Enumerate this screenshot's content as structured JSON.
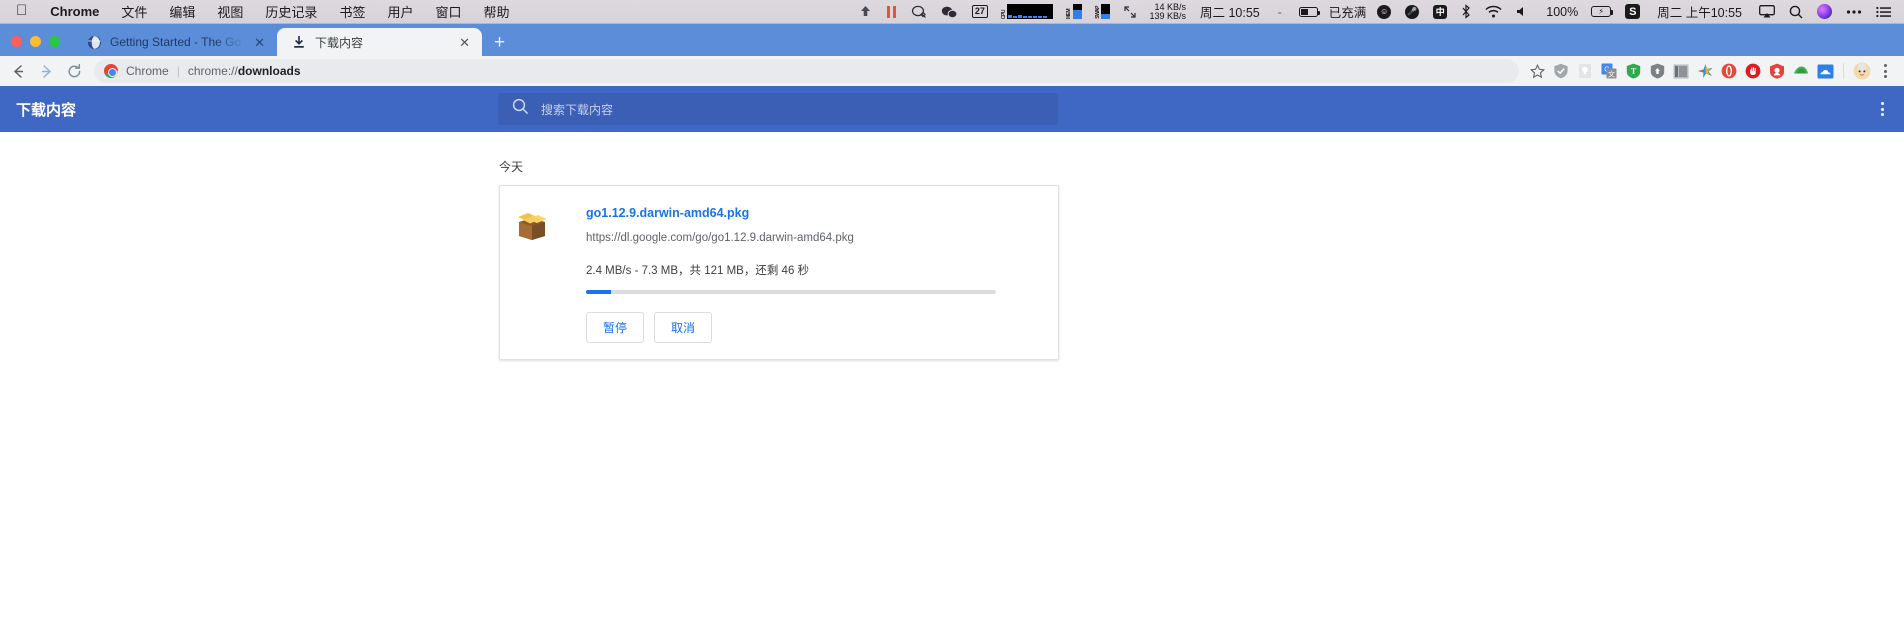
{
  "macos_menubar": {
    "apple_logo": "apple-logo",
    "app_name": "Chrome",
    "menus": [
      "文件",
      "编辑",
      "视图",
      "历史记录",
      "书签",
      "用户",
      "窗口",
      "帮助"
    ],
    "status_icons": [
      "upload-arrow-icon",
      "pause-bars-icon",
      "chat-bubble-icon",
      "wechat-icon",
      "calendar-icon"
    ],
    "calendar_day": "27",
    "monitors": [
      {
        "label": "CPU"
      },
      {
        "label": "MEM"
      },
      {
        "label": "SWAP"
      }
    ],
    "network_down": "14 KB/s",
    "network_up": "139 KB/s",
    "clock_left": "周二 10:55",
    "battery_status": "已充满",
    "input_method": "中",
    "volume_percent": "100%",
    "sogou_label": "S",
    "clock_right": "周二 上午10:55",
    "right_icons": [
      "emoji-icon",
      "microphone-icon",
      "input-method-icon",
      "bluetooth-icon",
      "wifi-icon",
      "volume-icon",
      "battery-charging-icon",
      "sogou-icon",
      "airplay-icon",
      "spotlight-search-icon",
      "siri-icon",
      "control-center-icon",
      "notification-center-icon"
    ]
  },
  "browser": {
    "window_controls": [
      "close",
      "minimize",
      "maximize"
    ],
    "tabs": [
      {
        "title": "Getting Started - The Go Progr",
        "favicon": "globe-icon",
        "active": false
      },
      {
        "title": "下载内容",
        "favicon": "download-icon",
        "active": true
      }
    ],
    "new_tab_label": "+",
    "nav": {
      "back": "back-arrow",
      "forward": "forward-arrow",
      "reload": "reload-arrow"
    },
    "omnibox": {
      "site_label": "Chrome",
      "separator": "|",
      "url_host": "chrome://",
      "url_path": "downloads"
    },
    "extensions": [
      "bookmark-star-icon",
      "adblock-shield-icon",
      "keep-lightbulb-icon",
      "google-translate-icon",
      "tampermonkey-icon",
      "privacy-badger-icon",
      "reader-mode-icon",
      "colorful-star-icon",
      "opera-vpn-icon",
      "adguard-icon",
      "momentum-icon",
      "evernote-icon",
      "onedrive-icon"
    ],
    "profile_avatar": "avatar-icon",
    "menu_label": "chrome-menu-icon"
  },
  "downloads_page": {
    "title": "下载内容",
    "search_placeholder": "搜索下载内容",
    "search_value": "",
    "search_icon": "search-icon",
    "more_menu": "more-vertical-icon",
    "section_label": "今天",
    "item": {
      "file_icon": "package-box-icon",
      "filename": "go1.12.9.darwin-amd64.pkg",
      "url": "https://dl.google.com/go/go1.12.9.darwin-amd64.pkg",
      "status": "2.4 MB/s - 7.3 MB，共 121 MB，还剩 46 秒",
      "progress_percent": 6,
      "speed": "2.4 MB/s",
      "downloaded": "7.3 MB",
      "total": "121 MB",
      "time_remaining": "46 秒",
      "pause_label": "暂停",
      "cancel_label": "取消"
    }
  },
  "colors": {
    "chrome_blue": "#5b8dd9",
    "header_blue": "#3f68c4",
    "link_blue": "#1a73e8",
    "search_field": "#3a5fb5"
  }
}
